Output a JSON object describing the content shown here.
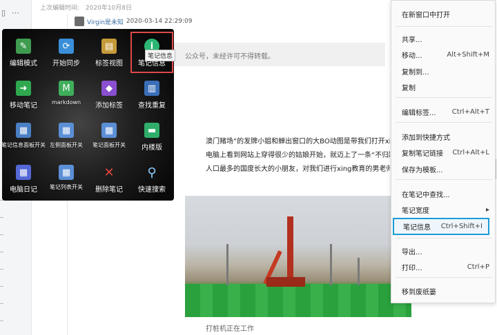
{
  "left_strip": {
    "icon_a": "▯",
    "icon_b": "⋯"
  },
  "header": {
    "last_edit_label": "上次编辑时间:",
    "last_edit_value": "2020年10月8日"
  },
  "article": {
    "author": "Virgin是未知",
    "date": "2020-03-14 22:29:09",
    "quote_fragment": "公众号，未经许可不得转载。",
    "paragraphs": [
      "澳门赌场”的发牌小姐和蝉出窗口的大BO动图是带我们打开xing启蒙之门",
      "电脑上看到网站上穿得很少的姑娘开始，就迈上了一条“不归路”。",
      "人口最多的国度长大的小朋友，对我们进行xing教育的男老师，基本..."
    ],
    "caption": "打桩机正在工作"
  },
  "toolbar": {
    "tooltip": "笔记信息",
    "tools": [
      {
        "label": "编辑模式",
        "icon": "edit-mode-icon",
        "color": "#3f9b4f",
        "glyph": "✎"
      },
      {
        "label": "开始同步",
        "icon": "sync-icon",
        "color": "#3a8fd8",
        "glyph": "⟳"
      },
      {
        "label": "标签视图",
        "icon": "tag-view-icon",
        "color": "#c59a3a",
        "glyph": "▤"
      },
      {
        "label": "笔记信息",
        "icon": "info-icon",
        "color": "#2bb673",
        "glyph": "i"
      },
      {
        "label": "移动笔记",
        "icon": "move-note-icon",
        "color": "#2fa84f",
        "glyph": "➜"
      },
      {
        "label": "markdown",
        "icon": "markdown-icon",
        "color": "#3fae5a",
        "glyph": "M"
      },
      {
        "label": "添加标签",
        "icon": "add-tag-icon",
        "color": "#8a4fd0",
        "glyph": "◆"
      },
      {
        "label": "查找重复",
        "icon": "find-duplicate-icon",
        "color": "#3a6fb8",
        "glyph": "▥"
      },
      {
        "label": "笔记信息面板开关",
        "icon": "info-panel-toggle-icon",
        "color": "#4a7fc4",
        "glyph": "▦"
      },
      {
        "label": "左侧面板开关",
        "icon": "left-panel-toggle-icon",
        "color": "#5b8fd6",
        "glyph": "▦"
      },
      {
        "label": "笔记面板开关",
        "icon": "note-panel-toggle-icon",
        "color": "#5b8fd6",
        "glyph": "▦"
      },
      {
        "label": "内楼版",
        "icon": "trash-can-icon",
        "color": "#2fae6a",
        "glyph": "▬"
      },
      {
        "label": "电脑日记",
        "icon": "calendar-icon",
        "color": "#5468d6",
        "glyph": "▦"
      },
      {
        "label": "笔记列表开关",
        "icon": "note-list-toggle-icon",
        "color": "#5b8fd6",
        "glyph": "▦"
      },
      {
        "label": "删除笔记",
        "icon": "delete-icon",
        "color": "transparent",
        "glyph": "✕"
      },
      {
        "label": "快速搜索",
        "icon": "search-icon",
        "color": "transparent",
        "glyph": "⚲"
      }
    ]
  },
  "context_menu": {
    "items": [
      {
        "label": "在新窗口中打开",
        "shortcut": ""
      },
      {
        "label": "共享...",
        "shortcut": ""
      },
      {
        "label": "移动...",
        "shortcut": "Alt+Shift+M"
      },
      {
        "label": "复制到...",
        "shortcut": ""
      },
      {
        "label": "复制",
        "shortcut": ""
      },
      {
        "label": "编辑标签...",
        "shortcut": "Ctrl+Alt+T"
      },
      {
        "label": "添加到快捷方式",
        "shortcut": ""
      },
      {
        "label": "复制笔记链接",
        "shortcut": "Ctrl+Alt+L"
      },
      {
        "label": "保存为模板...",
        "shortcut": ""
      },
      {
        "label": "在笔记中查找...",
        "shortcut": ""
      },
      {
        "label": "笔记宽度",
        "shortcut": "▸"
      },
      {
        "label": "笔记信息",
        "shortcut": "Ctrl+Shift+I"
      },
      {
        "label": "导出...",
        "shortcut": ""
      },
      {
        "label": "打印...",
        "shortcut": "Ctrl+P"
      },
      {
        "label": "移到废纸篓",
        "shortcut": ""
      }
    ]
  }
}
